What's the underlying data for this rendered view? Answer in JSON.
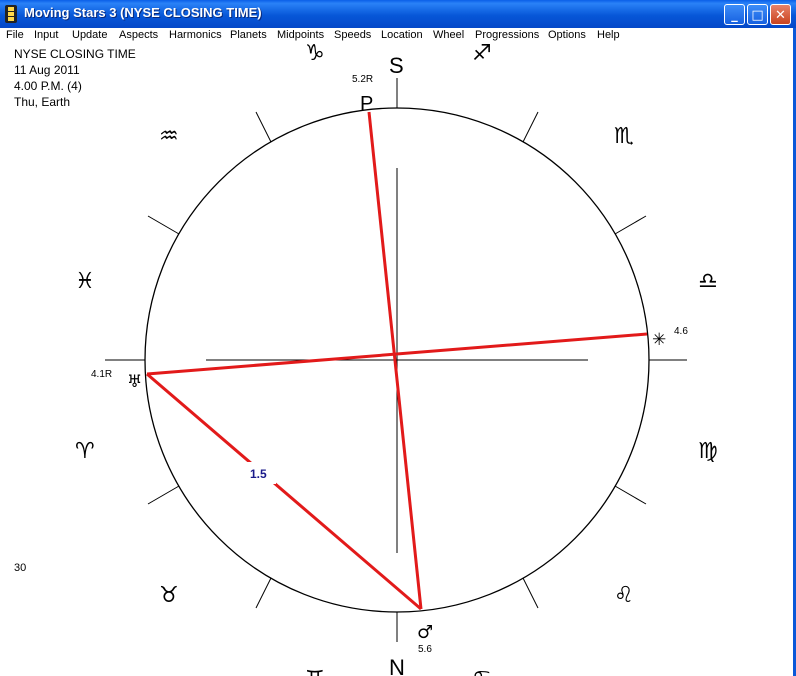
{
  "window": {
    "title": "Moving Stars 3 (NYSE CLOSING TIME)",
    "minimize": "_",
    "maximize": "□",
    "close": "✕"
  },
  "menu": [
    "File",
    "Input",
    "Update",
    "Aspects",
    "Harmonics",
    "Planets",
    "Midpoints",
    "Speeds",
    "Location",
    "Wheel",
    "Progressions",
    "Options",
    "Help"
  ],
  "info": {
    "line1": "NYSE CLOSING TIME",
    "line2": "11 Aug 2011",
    "line3": "4.00 P.M. (4)",
    "line4": "Thu, Earth"
  },
  "bottom_left_value": "30",
  "compass": {
    "south": "S",
    "north": "N"
  },
  "zodiac": {
    "capricorn": "♑",
    "sagittarius": "♐",
    "aquarius": "♒",
    "scorpio": "♏",
    "pisces": "♓",
    "libra": "♎",
    "aries": "♈",
    "virgo": "♍",
    "taurus": "♉",
    "leo": "♌",
    "gemini": "♊",
    "cancer": "♋"
  },
  "planets": {
    "pluto": {
      "glyph": "P",
      "speed": "5.2R"
    },
    "uranus": {
      "glyph": "♅",
      "speed": "4.1R"
    },
    "star": {
      "glyph": "✳",
      "speed": "4.6"
    },
    "mars": {
      "glyph": "♂",
      "speed": "5.6"
    }
  },
  "aspect_label": "1.5",
  "colors": {
    "aspect_line": "#e21a1a",
    "titlebar": "#0757d8",
    "aspect_label": "#1a1a8a"
  }
}
